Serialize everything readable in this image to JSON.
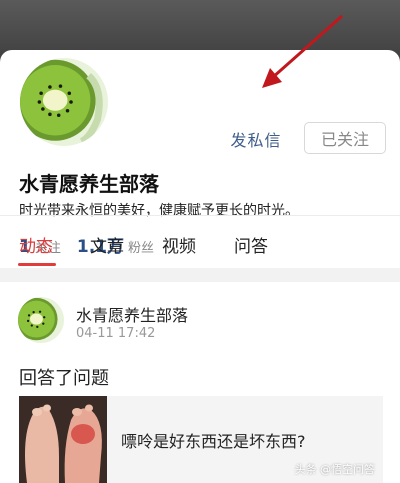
{
  "profile": {
    "name": "水青愿养生部落",
    "bio": "时光带来永恒的美好，健康赋予更长的时光。",
    "message_button": "发私信",
    "follow_button": "已关注",
    "stats": [
      {
        "value": "1",
        "label": "关注"
      },
      {
        "value": "1.1万",
        "label": "粉丝"
      }
    ]
  },
  "tabs": [
    {
      "label": "动态",
      "active": true
    },
    {
      "label": "文章",
      "active": false
    },
    {
      "label": "视频",
      "active": false
    },
    {
      "label": "问答",
      "active": false
    }
  ],
  "post": {
    "author": "水青愿养生部落",
    "time": "04-11 17:42",
    "action": "回答了问题",
    "question": "嘌呤是好东西还是坏东西?",
    "watermark": "头条 @悟空问答"
  },
  "colors": {
    "accent_red": "#e23b3b",
    "link_blue": "#3f5e8c",
    "stat_blue": "#2c4f86"
  }
}
